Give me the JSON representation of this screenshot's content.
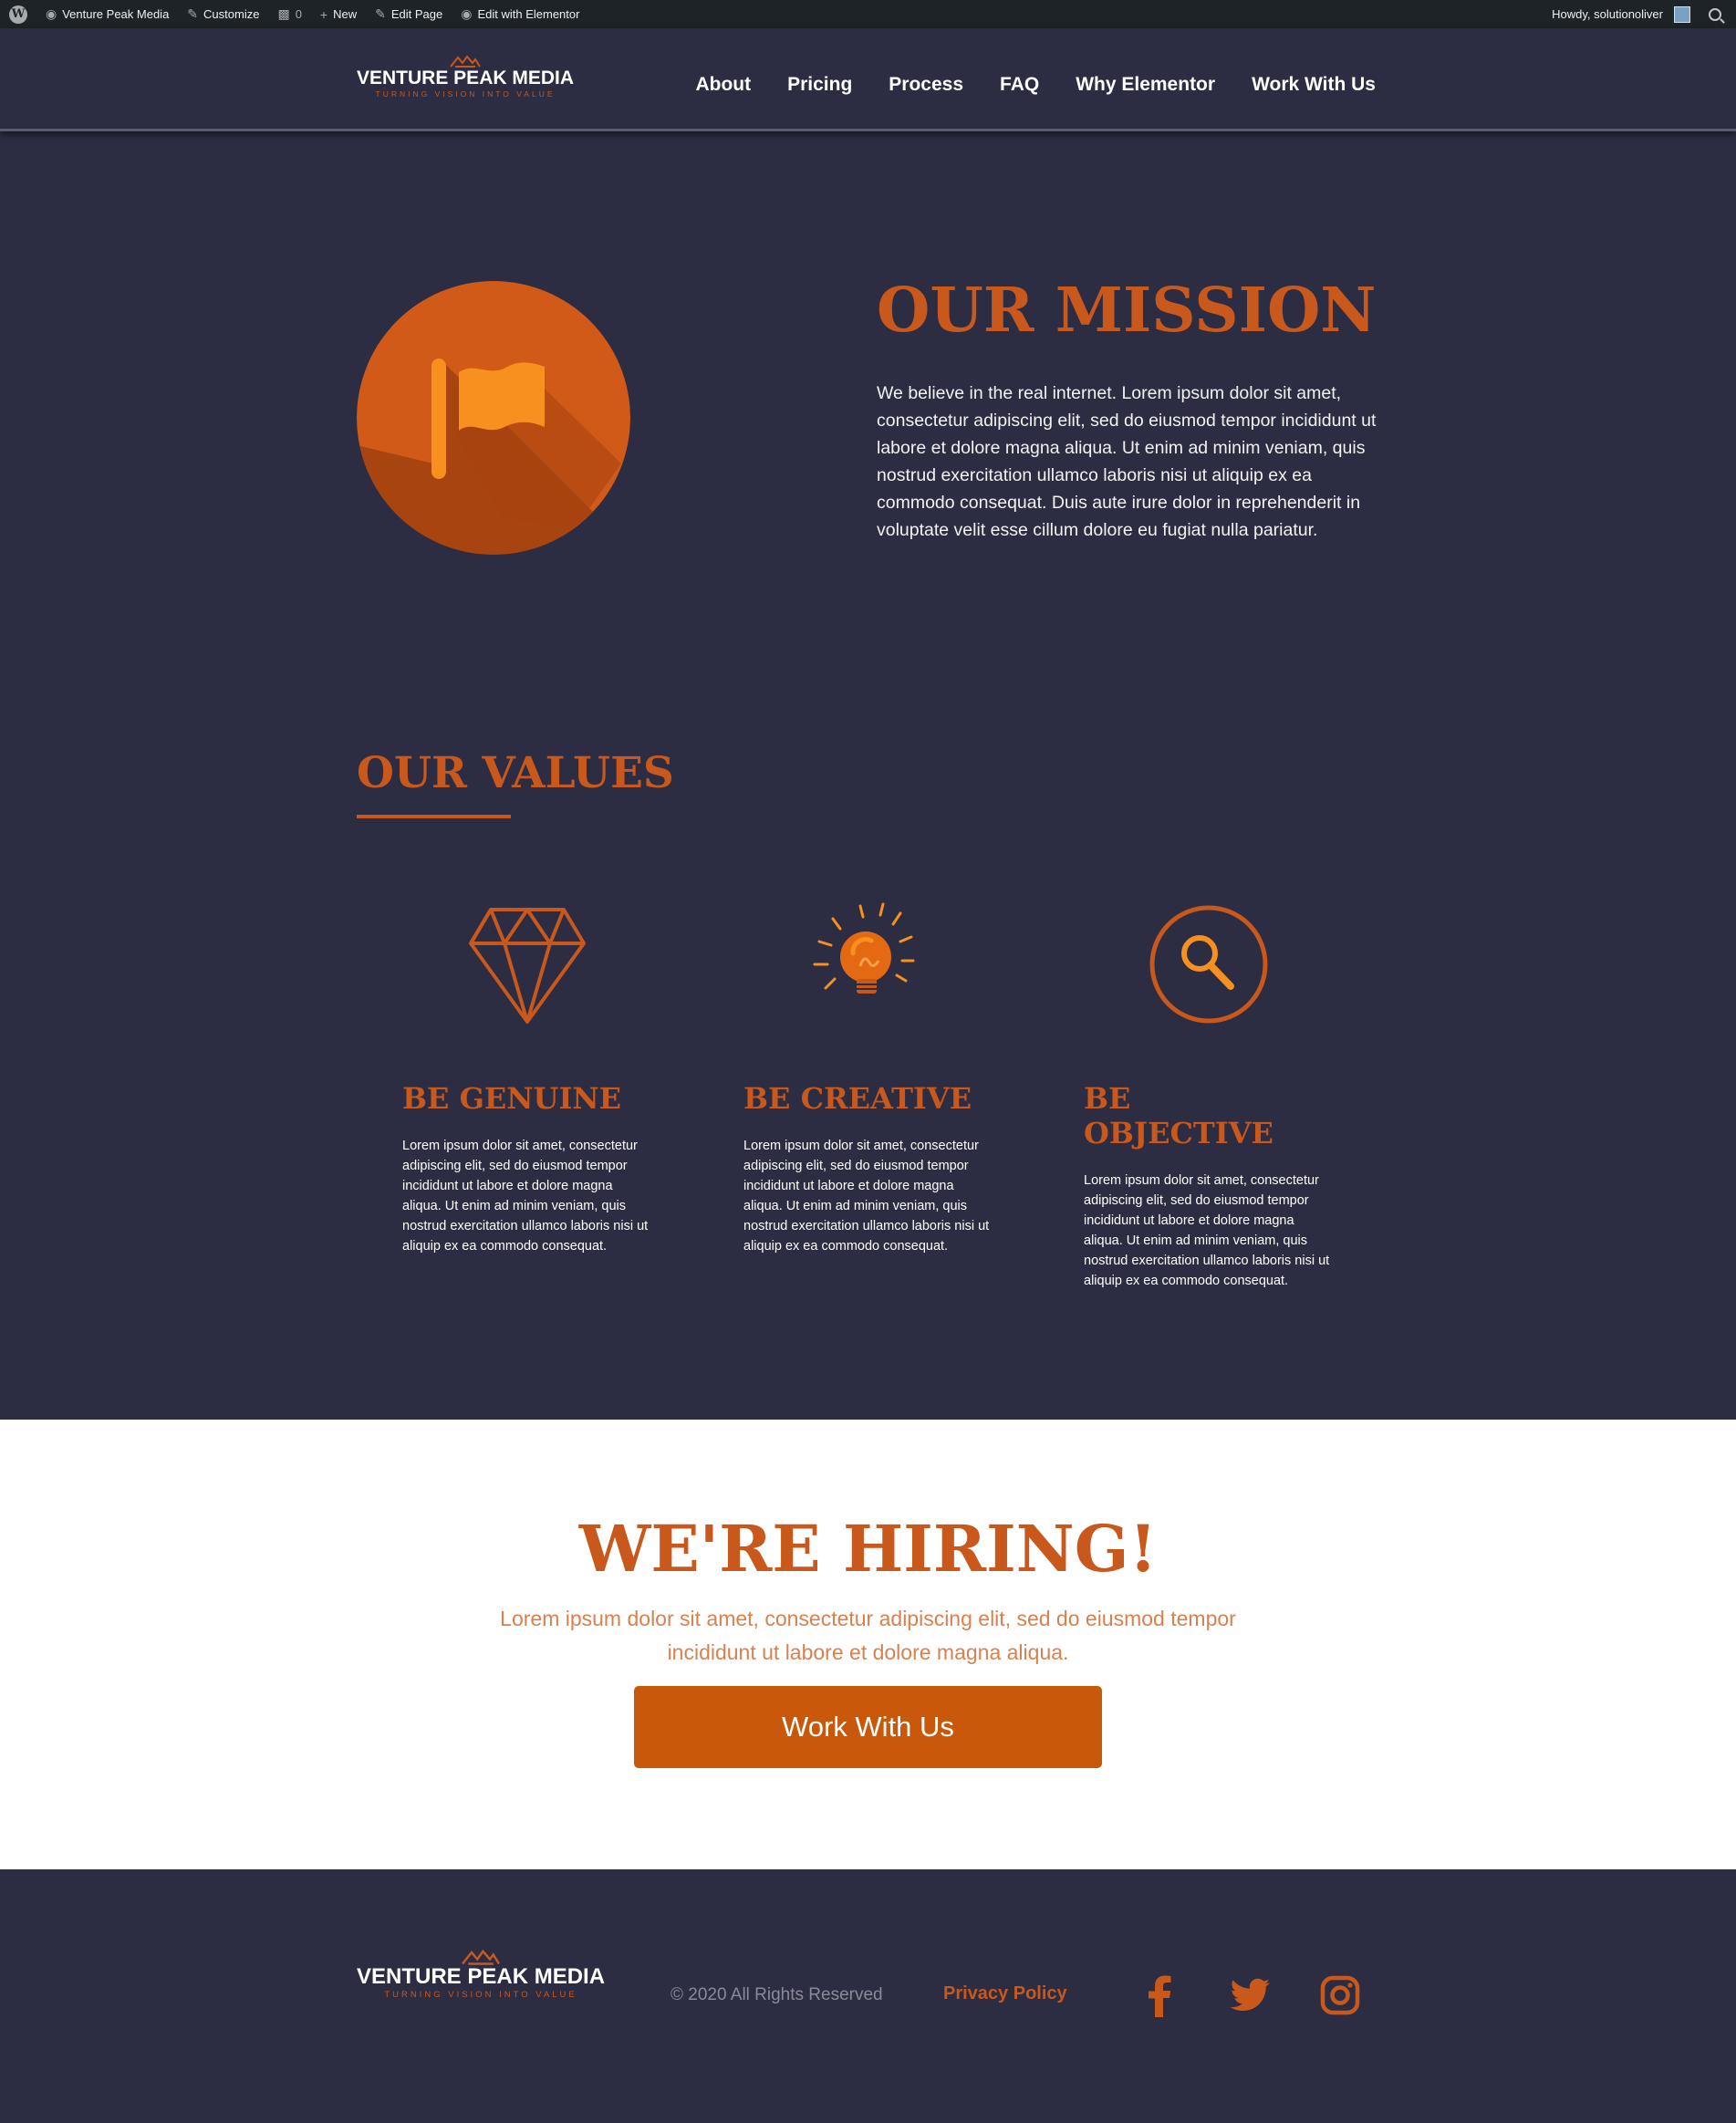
{
  "admin_bar": {
    "site_name": "Venture Peak Media",
    "customize": "Customize",
    "comments_count": "0",
    "new": "New",
    "edit_page": "Edit Page",
    "edit_elementor": "Edit with Elementor",
    "howdy": "Howdy, solutionoliver"
  },
  "brand": {
    "name": "VENTURE PEAK MEDIA",
    "tagline": "TURNING VISION INTO VALUE"
  },
  "nav": {
    "items": [
      "About",
      "Pricing",
      "Process",
      "FAQ",
      "Why Elementor",
      "Work With Us"
    ]
  },
  "mission": {
    "icon": "flag-icon",
    "title": "OUR MISSION",
    "text": "We believe in the real internet. Lorem ipsum dolor sit amet, consectetur adipiscing elit, sed do eiusmod tempor incididunt ut labore et dolore magna aliqua. Ut enim ad minim veniam, quis nostrud exercitation ullamco laboris nisi ut aliquip ex ea commodo consequat. Duis aute irure dolor in reprehenderit in voluptate velit esse cillum dolore eu fugiat nulla pariatur."
  },
  "values": {
    "title": "OUR VALUES",
    "items": [
      {
        "icon": "diamond-icon",
        "title": "BE GENUINE",
        "text": "Lorem ipsum dolor sit amet, consectetur adipiscing elit, sed do eiusmod tempor incididunt ut labore et dolore magna aliqua. Ut enim ad minim veniam, quis nostrud exercitation ullamco laboris nisi ut aliquip ex ea commodo consequat."
      },
      {
        "icon": "lightbulb-icon",
        "title": "BE CREATIVE",
        "text": "Lorem ipsum dolor sit amet, consectetur adipiscing elit, sed do eiusmod tempor incididunt ut labore et dolore magna aliqua. Ut enim ad minim veniam, quis nostrud exercitation ullamco laboris nisi ut aliquip ex ea commodo consequat."
      },
      {
        "icon": "magnifier-icon",
        "title": "BE OBJECTIVE",
        "text": "Lorem ipsum dolor sit amet, consectetur adipiscing elit, sed do eiusmod tempor incididunt ut labore et dolore magna aliqua. Ut enim ad minim veniam, quis nostrud exercitation ullamco laboris nisi ut aliquip ex ea commodo consequat."
      }
    ]
  },
  "hiring": {
    "title": "WE'RE HIRING!",
    "text": "Lorem ipsum dolor sit amet, consectetur adipiscing elit, sed do eiusmod tempor incididunt ut labore et dolore magna aliqua.",
    "button": "Work With Us"
  },
  "footer": {
    "copyright": "© 2020 All Rights Reserved",
    "privacy": "Privacy Policy",
    "social": [
      "facebook-icon",
      "twitter-icon",
      "instagram-icon"
    ]
  },
  "colors": {
    "background": "#2c2c42",
    "accent": "#c9581c",
    "button": "#c9580a",
    "admin_bar": "#1d2327"
  }
}
